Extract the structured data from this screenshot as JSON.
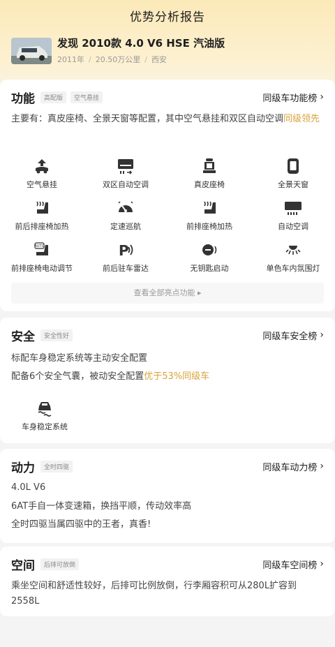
{
  "header": {
    "title": "优势分析报告",
    "car_name": "发现 2010款 4.0 V6 HSE 汽油版",
    "meta": [
      "2011年",
      "20.50万公里",
      "西安"
    ],
    "meta_sep": "/"
  },
  "function": {
    "title": "功能",
    "tags": [
      "高配版",
      "空气悬挂"
    ],
    "rank_label": "同级车功能榜",
    "desc_main": "主要有：真皮座椅、全景天窗等配置，其中空气悬挂和双区自动空调",
    "desc_highlight": "同级领先",
    "features": [
      {
        "label": "空气悬挂",
        "icon": "air-suspension-icon"
      },
      {
        "label": "双区自动空调",
        "icon": "dual-zone-ac-icon"
      },
      {
        "label": "真皮座椅",
        "icon": "leather-seat-icon"
      },
      {
        "label": "全景天窗",
        "icon": "panoramic-sunroof-icon"
      },
      {
        "label": "前后排座椅加热",
        "icon": "seat-heating-icon"
      },
      {
        "label": "定速巡航",
        "icon": "cruise-control-icon"
      },
      {
        "label": "前排座椅加热",
        "icon": "seat-heating-icon"
      },
      {
        "label": "自动空调",
        "icon": "auto-ac-icon"
      },
      {
        "label": "前排座椅电动调节",
        "icon": "power-seat-icon"
      },
      {
        "label": "前后驻车雷达",
        "icon": "parking-radar-icon"
      },
      {
        "label": "无钥匙启动",
        "icon": "keyless-start-icon"
      },
      {
        "label": "单色车内氛围灯",
        "icon": "ambient-light-icon"
      }
    ],
    "view_all_label": "查看全部亮点功能",
    "view_all_arrow": "▸"
  },
  "safety": {
    "title": "安全",
    "tags": [
      "安全性好"
    ],
    "rank_label": "同级车安全榜",
    "line1": "标配车身稳定系统等主动安全配置",
    "line2_main": "配备6个安全气囊，被动安全配置",
    "line2_highlight": "优于53%同级车",
    "features": [
      {
        "label": "车身稳定系统",
        "icon": "stability-control-icon"
      }
    ]
  },
  "power": {
    "title": "动力",
    "tags": [
      "全时四驱"
    ],
    "rank_label": "同级车动力榜",
    "lines": [
      "4.0L V6",
      "6AT手自一体变速箱，换挡平顺，传动效率高",
      "全时四驱当属四驱中的王者，真香!"
    ]
  },
  "space": {
    "title": "空间",
    "tags": [
      "后排可放倒"
    ],
    "rank_label": "同级车空间榜",
    "desc": "乘坐空间和舒适性较好，后排可比例放倒，行李厢容积可从280L扩容到2558L"
  },
  "chevron": "›",
  "colors": {
    "highlight": "#d9a23a",
    "hero_bg": "#fbe9b8"
  }
}
